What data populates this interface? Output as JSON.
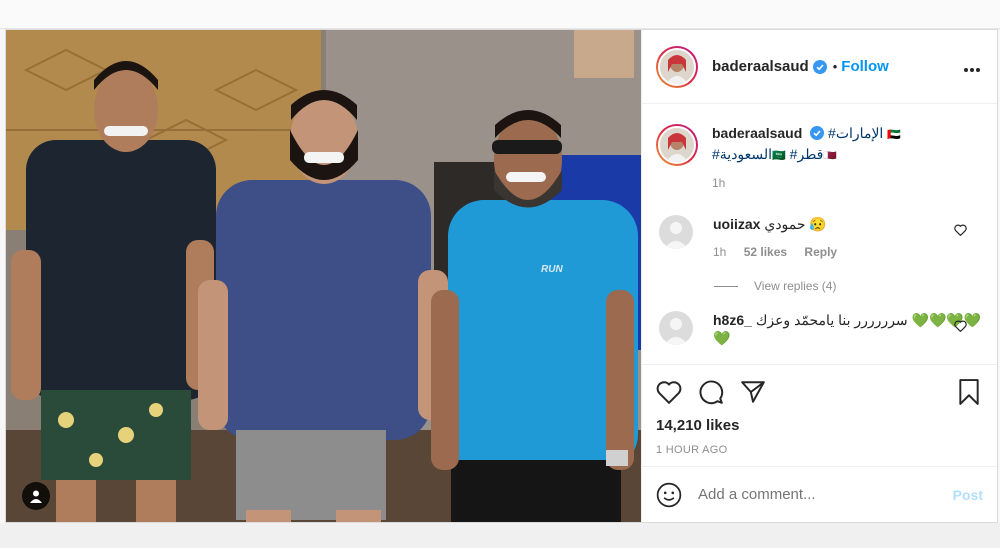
{
  "post": {
    "username": "baderaalsaud",
    "follow_label": "Follow",
    "dot": "•",
    "more_icon": "more-options-icon",
    "caption": {
      "username": "baderaalsaud",
      "line1_tag": "#الإمارات",
      "line1_flag": "🇦🇪",
      "line2_tag_a": "#السعودية",
      "line2_flag_a": "🇸🇦",
      "line2_tag_b": "#قطر",
      "line2_flag_b": "🇶🇦",
      "time": "1h"
    },
    "comments": [
      {
        "username": "uoiizax",
        "text": "حمودي 😥",
        "time": "1h",
        "likes": "52 likes",
        "reply": "Reply",
        "view_replies": "View replies (4)"
      },
      {
        "username": "h8z6_",
        "text": "سرررررر بنا يامحمّد وعزك 💚💚💚💚💚"
      }
    ],
    "likes_count": "14,210 likes",
    "timestamp": "1 HOUR AGO",
    "add_comment_placeholder": "Add a comment...",
    "post_label": "Post"
  },
  "colors": {
    "accent": "#0095f6",
    "hashtag": "#00376b",
    "muted": "#8e8e8e"
  }
}
